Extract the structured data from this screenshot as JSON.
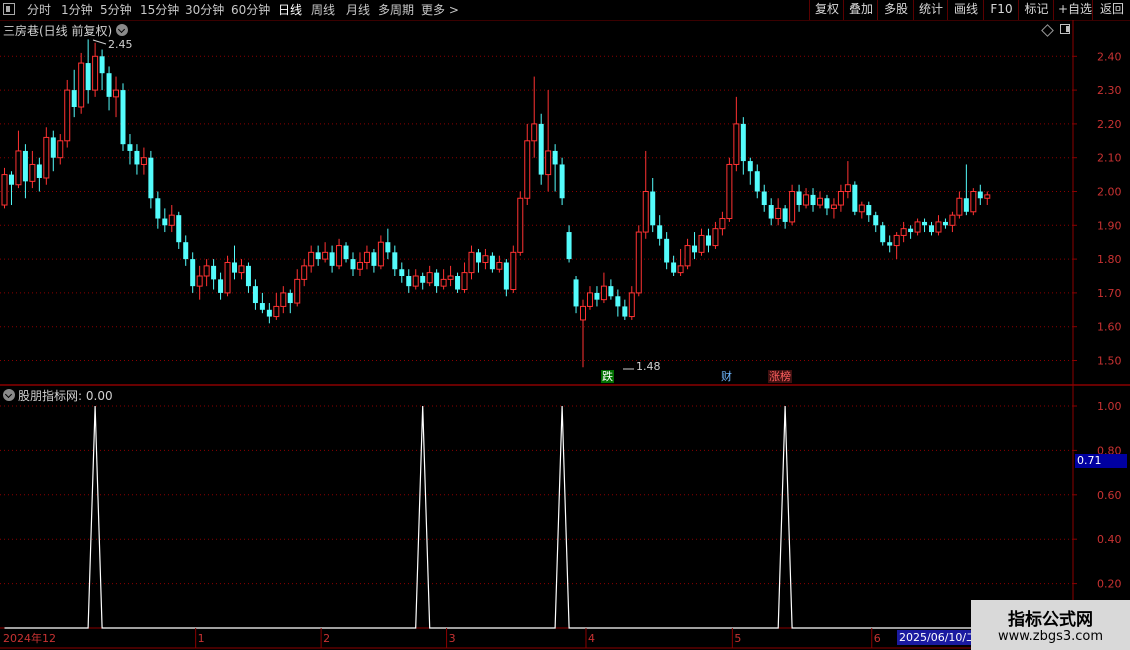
{
  "toolbar": {
    "left_items": [
      "分时",
      "1分钟",
      "5分钟",
      "15分钟",
      "30分钟",
      "60分钟",
      "日线",
      "周线",
      "月线",
      "多周期",
      "更多 >"
    ],
    "active_index": 6,
    "right_items": [
      "复权",
      "叠加",
      "多股",
      "统计",
      "画线",
      "F10",
      "标记",
      "+自选",
      "返回"
    ]
  },
  "main_panel": {
    "title": "三房巷(日线 前复权)",
    "y_ticks": [
      "2.40",
      "2.30",
      "2.20",
      "2.10",
      "2.00",
      "1.90",
      "1.80",
      "1.70",
      "1.60",
      "1.50"
    ],
    "high_label": "2.45",
    "low_label": "1.48",
    "markers": [
      {
        "text": "跌",
        "color": "#00c000"
      },
      {
        "text": "财",
        "color": "#4fa3ff"
      },
      {
        "text": "涨榜",
        "color": "#ff5050"
      }
    ]
  },
  "indicator_panel": {
    "title": "股朋指标网",
    "value": ": 0.00",
    "y_ticks": [
      "1.00",
      "0.80",
      "0.60",
      "0.40",
      "0.20"
    ],
    "current_value": "0.71",
    "spikes": [
      0.0,
      0.0,
      0.0,
      0.0,
      0.0,
      0.0,
      0.0,
      0.0,
      0.0,
      0.0,
      0.0,
      0.0,
      0.0,
      0.0,
      0.0,
      0.0,
      0.0,
      0.0,
      0.0,
      0.0,
      0.0,
      0.0,
      0.0,
      0.0,
      0.0,
      0.0,
      0.0,
      0.0,
      0.0,
      0.0,
      0.0,
      0.0,
      0.0,
      0.0,
      0.0,
      0.0,
      0.0,
      0.0,
      0.0,
      0.0,
      0.0,
      0.0,
      0.0,
      0.0,
      0.0,
      0.0,
      0.0,
      0.0,
      0.0,
      0.0,
      0.0,
      0.0,
      0.0,
      0.0,
      0.0,
      0.0,
      0.0,
      0.0,
      0.0,
      0.0,
      0.0,
      0.0,
      0.0,
      0.0,
      0.0,
      0.0,
      0.0,
      0.0,
      0.0,
      0.0,
      0.0,
      0.0,
      0.0,
      0.0,
      0.0,
      0.0,
      0.0,
      0.0,
      0.0,
      0.0,
      0.0,
      0.0,
      0.0,
      0.0,
      0.0,
      0.0,
      0.0,
      0.0,
      0.0,
      0.0,
      0.0,
      0.0,
      0.0,
      0.0,
      0.0,
      0.0,
      0.0,
      0.0,
      0.0,
      0.0,
      0.0,
      0.0,
      0.0,
      0.0,
      0.0,
      0.0,
      0.0,
      0.0,
      0.0,
      0.0,
      0.0,
      0.0,
      0.0,
      0.0,
      0.0,
      0.0,
      0.0,
      0.0,
      0.0,
      0.0,
      0.0,
      0.0,
      0.0,
      0.0,
      0.0,
      0.0,
      0.0,
      0.0,
      0.0,
      0.0,
      0.0,
      0.0,
      0.0,
      0.0,
      0.0,
      0.0,
      0.0,
      0.0,
      0.0,
      0.0,
      0.0,
      0.0,
      0.0,
      0.0,
      0.0,
      0.0,
      0.0,
      0.0,
      0.0,
      0.0,
      0.0,
      0.0,
      0.0,
      0.0,
      0.0
    ]
  },
  "x_axis": {
    "labels": [
      {
        "text": "2024年12",
        "i": 0
      },
      {
        "text": "1",
        "i": 28
      },
      {
        "text": "2",
        "i": 46
      },
      {
        "text": "3",
        "i": 64
      },
      {
        "text": "4",
        "i": 84
      },
      {
        "text": "5",
        "i": 105
      },
      {
        "text": "6",
        "i": 125
      }
    ],
    "date_box": "2025/06/10/二"
  },
  "watermark": {
    "line1": "指标公式网",
    "line2": "www.zbgs3.com"
  },
  "colors": {
    "up": "#ff3232",
    "down": "#54fcfc",
    "grid": "#8b0000",
    "axis_text": "#c83232",
    "indicator_line": "#ffffff",
    "value_box": "#0000a0"
  },
  "chart_data": {
    "type": "candlestick",
    "ylim": [
      1.45,
      2.48
    ],
    "candles": [
      [
        1.96,
        2.05,
        2.07,
        1.95
      ],
      [
        2.05,
        2.02,
        2.06,
        1.96
      ],
      [
        2.02,
        2.12,
        2.18,
        2.01
      ],
      [
        2.12,
        2.03,
        2.14,
        1.98
      ],
      [
        2.03,
        2.08,
        2.12,
        2.01
      ],
      [
        2.08,
        2.04,
        2.1,
        2.0
      ],
      [
        2.04,
        2.16,
        2.19,
        2.02
      ],
      [
        2.16,
        2.1,
        2.18,
        2.06
      ],
      [
        2.1,
        2.15,
        2.17,
        2.08
      ],
      [
        2.15,
        2.3,
        2.33,
        2.13
      ],
      [
        2.3,
        2.25,
        2.36,
        2.22
      ],
      [
        2.25,
        2.38,
        2.41,
        2.23
      ],
      [
        2.38,
        2.3,
        2.45,
        2.26
      ],
      [
        2.3,
        2.4,
        2.44,
        2.28
      ],
      [
        2.4,
        2.35,
        2.42,
        2.3
      ],
      [
        2.35,
        2.28,
        2.37,
        2.24
      ],
      [
        2.28,
        2.3,
        2.34,
        2.22
      ],
      [
        2.3,
        2.14,
        2.32,
        2.12
      ],
      [
        2.14,
        2.12,
        2.17,
        2.08
      ],
      [
        2.12,
        2.08,
        2.14,
        2.05
      ],
      [
        2.08,
        2.1,
        2.13,
        2.05
      ],
      [
        2.1,
        1.98,
        2.12,
        1.95
      ],
      [
        1.98,
        1.92,
        2.0,
        1.89
      ],
      [
        1.92,
        1.9,
        1.95,
        1.88
      ],
      [
        1.9,
        1.93,
        1.96,
        1.88
      ],
      [
        1.93,
        1.85,
        1.94,
        1.83
      ],
      [
        1.85,
        1.8,
        1.87,
        1.78
      ],
      [
        1.8,
        1.72,
        1.82,
        1.7
      ],
      [
        1.72,
        1.75,
        1.78,
        1.68
      ],
      [
        1.75,
        1.78,
        1.8,
        1.72
      ],
      [
        1.78,
        1.74,
        1.8,
        1.71
      ],
      [
        1.74,
        1.7,
        1.76,
        1.68
      ],
      [
        1.7,
        1.79,
        1.81,
        1.69
      ],
      [
        1.79,
        1.76,
        1.84,
        1.74
      ],
      [
        1.76,
        1.78,
        1.8,
        1.74
      ],
      [
        1.78,
        1.72,
        1.79,
        1.7
      ],
      [
        1.72,
        1.67,
        1.74,
        1.65
      ],
      [
        1.67,
        1.65,
        1.7,
        1.64
      ],
      [
        1.65,
        1.63,
        1.67,
        1.61
      ],
      [
        1.63,
        1.66,
        1.7,
        1.62
      ],
      [
        1.66,
        1.7,
        1.72,
        1.64
      ],
      [
        1.7,
        1.67,
        1.71,
        1.64
      ],
      [
        1.67,
        1.74,
        1.77,
        1.66
      ],
      [
        1.74,
        1.78,
        1.8,
        1.72
      ],
      [
        1.78,
        1.82,
        1.84,
        1.76
      ],
      [
        1.82,
        1.8,
        1.84,
        1.78
      ],
      [
        1.8,
        1.82,
        1.85,
        1.79
      ],
      [
        1.82,
        1.78,
        1.84,
        1.76
      ],
      [
        1.78,
        1.84,
        1.86,
        1.77
      ],
      [
        1.84,
        1.8,
        1.85,
        1.79
      ],
      [
        1.8,
        1.77,
        1.82,
        1.75
      ],
      [
        1.77,
        1.79,
        1.82,
        1.75
      ],
      [
        1.79,
        1.82,
        1.84,
        1.77
      ],
      [
        1.82,
        1.78,
        1.83,
        1.76
      ],
      [
        1.78,
        1.85,
        1.87,
        1.77
      ],
      [
        1.85,
        1.82,
        1.89,
        1.8
      ],
      [
        1.82,
        1.77,
        1.84,
        1.75
      ],
      [
        1.77,
        1.75,
        1.79,
        1.73
      ],
      [
        1.75,
        1.72,
        1.77,
        1.7
      ],
      [
        1.72,
        1.75,
        1.77,
        1.71
      ],
      [
        1.75,
        1.73,
        1.76,
        1.71
      ],
      [
        1.73,
        1.76,
        1.78,
        1.72
      ],
      [
        1.76,
        1.72,
        1.77,
        1.7
      ],
      [
        1.72,
        1.74,
        1.77,
        1.71
      ],
      [
        1.74,
        1.75,
        1.78,
        1.72
      ],
      [
        1.75,
        1.71,
        1.76,
        1.7
      ],
      [
        1.71,
        1.76,
        1.79,
        1.7
      ],
      [
        1.76,
        1.82,
        1.84,
        1.74
      ],
      [
        1.82,
        1.79,
        1.83,
        1.76
      ],
      [
        1.79,
        1.81,
        1.83,
        1.77
      ],
      [
        1.81,
        1.77,
        1.82,
        1.76
      ],
      [
        1.77,
        1.79,
        1.81,
        1.76
      ],
      [
        1.79,
        1.71,
        1.8,
        1.69
      ],
      [
        1.71,
        1.82,
        1.84,
        1.7
      ],
      [
        1.82,
        1.98,
        2.0,
        1.81
      ],
      [
        1.98,
        2.15,
        2.2,
        1.96
      ],
      [
        2.15,
        2.2,
        2.34,
        2.1
      ],
      [
        2.2,
        2.05,
        2.23,
        2.02
      ],
      [
        2.05,
        2.12,
        2.3,
        2.0
      ],
      [
        2.12,
        2.08,
        2.14,
        2.0
      ],
      [
        2.08,
        1.98,
        2.1,
        1.96
      ],
      [
        1.88,
        1.8,
        1.9,
        1.79
      ],
      [
        1.74,
        1.66,
        1.75,
        1.64
      ],
      [
        1.62,
        1.66,
        1.68,
        1.48
      ],
      [
        1.66,
        1.7,
        1.72,
        1.65
      ],
      [
        1.7,
        1.68,
        1.72,
        1.66
      ],
      [
        1.68,
        1.72,
        1.76,
        1.67
      ],
      [
        1.72,
        1.69,
        1.74,
        1.68
      ],
      [
        1.69,
        1.66,
        1.71,
        1.63
      ],
      [
        1.66,
        1.63,
        1.68,
        1.62
      ],
      [
        1.63,
        1.7,
        1.72,
        1.62
      ],
      [
        1.7,
        1.88,
        1.9,
        1.69
      ],
      [
        1.88,
        2.0,
        2.12,
        1.86
      ],
      [
        2.0,
        1.9,
        2.04,
        1.88
      ],
      [
        1.9,
        1.86,
        1.93,
        1.84
      ],
      [
        1.86,
        1.79,
        1.88,
        1.77
      ],
      [
        1.79,
        1.76,
        1.81,
        1.75
      ],
      [
        1.76,
        1.78,
        1.83,
        1.75
      ],
      [
        1.78,
        1.84,
        1.86,
        1.77
      ],
      [
        1.84,
        1.82,
        1.88,
        1.8
      ],
      [
        1.82,
        1.87,
        1.89,
        1.81
      ],
      [
        1.87,
        1.84,
        1.89,
        1.82
      ],
      [
        1.84,
        1.89,
        1.91,
        1.83
      ],
      [
        1.89,
        1.92,
        1.94,
        1.87
      ],
      [
        1.92,
        2.08,
        2.1,
        1.91
      ],
      [
        2.08,
        2.2,
        2.28,
        2.06
      ],
      [
        2.2,
        2.09,
        2.22,
        2.05
      ],
      [
        2.09,
        2.06,
        2.1,
        2.02
      ],
      [
        2.06,
        2.0,
        2.08,
        1.98
      ],
      [
        2.0,
        1.96,
        2.02,
        1.94
      ],
      [
        1.96,
        1.92,
        1.98,
        1.9
      ],
      [
        1.92,
        1.95,
        1.98,
        1.9
      ],
      [
        1.95,
        1.91,
        1.96,
        1.89
      ],
      [
        1.91,
        2.0,
        2.02,
        1.9
      ],
      [
        2.0,
        1.96,
        2.02,
        1.94
      ],
      [
        1.96,
        1.99,
        2.01,
        1.95
      ],
      [
        1.99,
        1.96,
        2.01,
        1.94
      ],
      [
        1.96,
        1.98,
        2.0,
        1.95
      ],
      [
        1.98,
        1.95,
        1.99,
        1.93
      ],
      [
        1.95,
        1.96,
        1.98,
        1.92
      ],
      [
        1.96,
        2.0,
        2.02,
        1.94
      ],
      [
        2.0,
        2.02,
        2.09,
        1.98
      ],
      [
        2.02,
        1.94,
        2.03,
        1.93
      ],
      [
        1.94,
        1.96,
        1.97,
        1.92
      ],
      [
        1.96,
        1.93,
        1.97,
        1.91
      ],
      [
        1.93,
        1.9,
        1.94,
        1.88
      ],
      [
        1.9,
        1.85,
        1.91,
        1.84
      ],
      [
        1.85,
        1.84,
        1.87,
        1.82
      ],
      [
        1.84,
        1.87,
        1.88,
        1.8
      ],
      [
        1.87,
        1.89,
        1.91,
        1.85
      ],
      [
        1.89,
        1.88,
        1.9,
        1.86
      ],
      [
        1.88,
        1.91,
        1.92,
        1.87
      ],
      [
        1.91,
        1.9,
        1.92,
        1.88
      ],
      [
        1.9,
        1.88,
        1.91,
        1.87
      ],
      [
        1.88,
        1.91,
        1.93,
        1.87
      ],
      [
        1.91,
        1.9,
        1.92,
        1.89
      ],
      [
        1.9,
        1.93,
        1.94,
        1.88
      ],
      [
        1.93,
        1.98,
        2.0,
        1.92
      ],
      [
        1.98,
        1.94,
        2.08,
        1.93
      ],
      [
        1.94,
        2.0,
        2.01,
        1.93
      ],
      [
        2.0,
        1.98,
        2.02,
        1.96
      ],
      [
        1.98,
        1.99,
        2.0,
        1.96
      ]
    ]
  }
}
